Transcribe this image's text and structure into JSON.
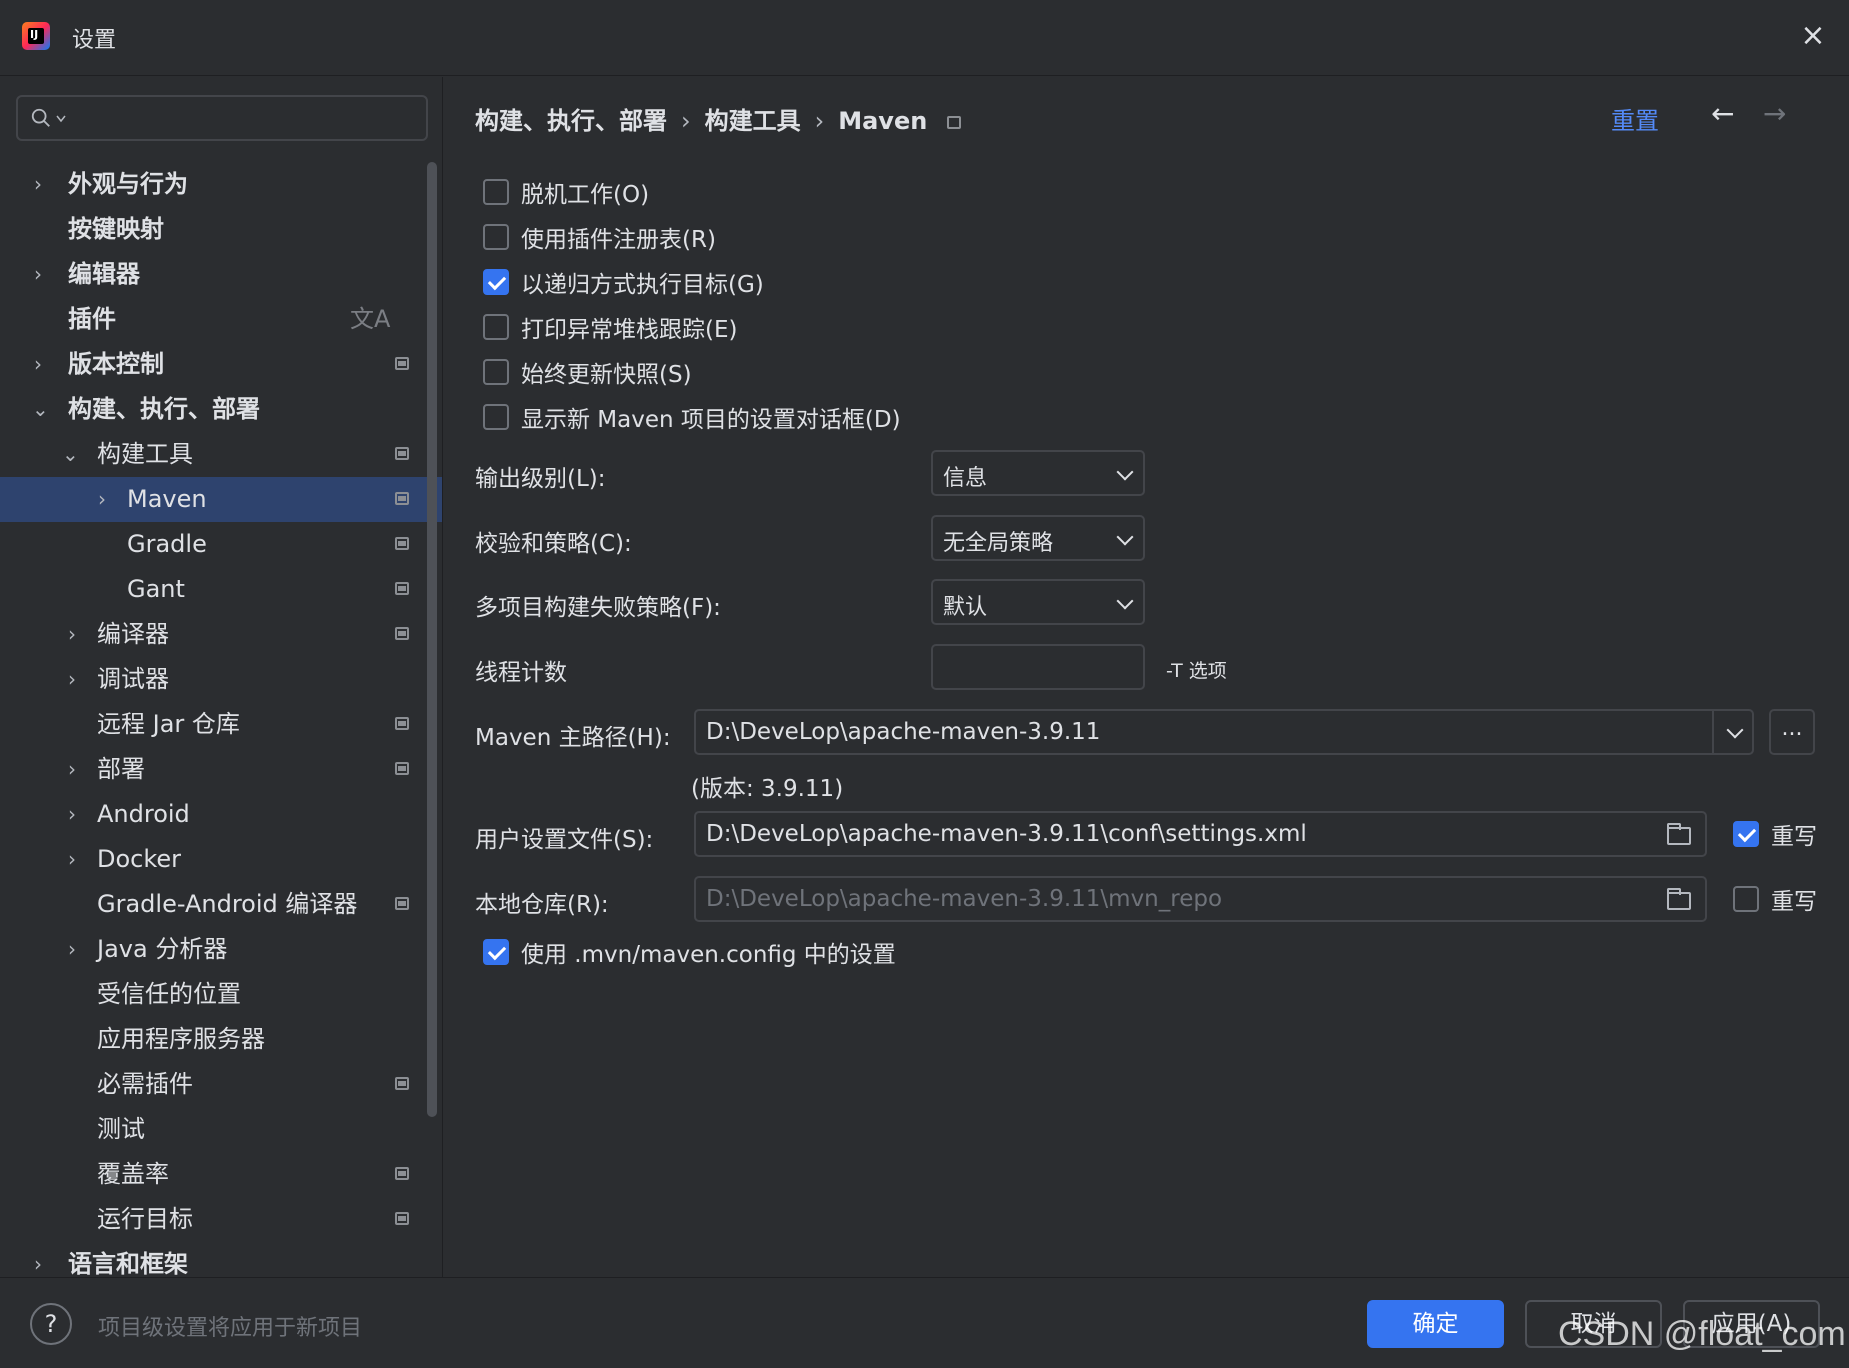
{
  "window": {
    "title": "设置",
    "close_label": "×"
  },
  "sidebar": {
    "search_placeholder": "",
    "items": [
      {
        "label": "外观与行为",
        "chevron": "›",
        "bold": true
      },
      {
        "label": "按键映射",
        "chevron": "",
        "bold": true
      },
      {
        "label": "编辑器",
        "chevron": "›",
        "bold": true
      },
      {
        "label": "插件",
        "chevron": "",
        "bold": true,
        "translate_icon": "文A"
      },
      {
        "label": "版本控制",
        "chevron": "›",
        "bold": true
      },
      {
        "label": "构建、执行、部署",
        "chevron": "⌄",
        "bold": true
      },
      {
        "label": "构建工具",
        "chevron": "⌄"
      },
      {
        "label": "Maven",
        "chevron": "›"
      },
      {
        "label": "Gradle",
        "chevron": ""
      },
      {
        "label": "Gant",
        "chevron": ""
      },
      {
        "label": "编译器",
        "chevron": "›"
      },
      {
        "label": "调试器",
        "chevron": "›"
      },
      {
        "label": "远程 Jar 仓库",
        "chevron": ""
      },
      {
        "label": "部署",
        "chevron": "›"
      },
      {
        "label": "Android",
        "chevron": "›"
      },
      {
        "label": "Docker",
        "chevron": "›"
      },
      {
        "label": "Gradle-Android 编译器",
        "chevron": ""
      },
      {
        "label": "Java 分析器",
        "chevron": "›"
      },
      {
        "label": "受信任的位置",
        "chevron": ""
      },
      {
        "label": "应用程序服务器",
        "chevron": ""
      },
      {
        "label": "必需插件",
        "chevron": ""
      },
      {
        "label": "测试",
        "chevron": ""
      },
      {
        "label": "覆盖率",
        "chevron": ""
      },
      {
        "label": "运行目标",
        "chevron": ""
      },
      {
        "label": "语言和框架",
        "chevron": "›",
        "bold": true
      }
    ]
  },
  "header": {
    "breadcrumb": [
      "构建、执行、部署",
      "构建工具",
      "Maven"
    ],
    "separator": "›",
    "reset_label": "重置",
    "back_icon": "←",
    "forward_icon": "→"
  },
  "options": {
    "offline": {
      "label": "脱机工作(O)",
      "checked": false
    },
    "plugin_registry": {
      "label": "使用插件注册表(R)",
      "checked": false
    },
    "recursive": {
      "label": "以递归方式执行目标(G)",
      "checked": true
    },
    "print_stack": {
      "label": "打印异常堆栈跟踪(E)",
      "checked": false
    },
    "update_snapshots": {
      "label": "始终更新快照(S)",
      "checked": false
    },
    "show_dialog": {
      "label": "显示新 Maven 项目的设置对话框(D)",
      "checked": false
    },
    "use_mvn_config": {
      "label": "使用 .mvn/maven.config 中的设置",
      "checked": true
    }
  },
  "fields": {
    "output_level": {
      "label": "输出级别(L):",
      "value": "信息"
    },
    "checksum_policy": {
      "label": "校验和策略(C):",
      "value": "无全局策略"
    },
    "multiproject_fail": {
      "label": "多项目构建失败策略(F):",
      "value": "默认"
    },
    "thread_count": {
      "label": "线程计数",
      "value": "",
      "hint": "-T 选项"
    },
    "maven_home": {
      "label": "Maven 主路径(H):",
      "value": "D:\\DeveLop\\apache-maven-3.9.11",
      "version": "(版本: 3.9.11)",
      "browse_label": "..."
    },
    "user_settings": {
      "label": "用户设置文件(S):",
      "value": "D:\\DeveLop\\apache-maven-3.9.11\\conf\\settings.xml",
      "override_label": "重写",
      "override_checked": true
    },
    "local_repo": {
      "label": "本地仓库(R):",
      "value": "D:\\DeveLop\\apache-maven-3.9.11\\mvn_repo",
      "override_label": "重写",
      "override_checked": false
    }
  },
  "footer": {
    "help_label": "?",
    "note": "项目级设置将应用于新项目",
    "ok_label": "确定",
    "cancel_label": "取消",
    "apply_label": "应用(A)",
    "watermark": "CSDN @float_com"
  },
  "colors": {
    "accent": "#3574f0",
    "link": "#548af7",
    "selection": "#2e436e",
    "background": "#2b2d30"
  }
}
